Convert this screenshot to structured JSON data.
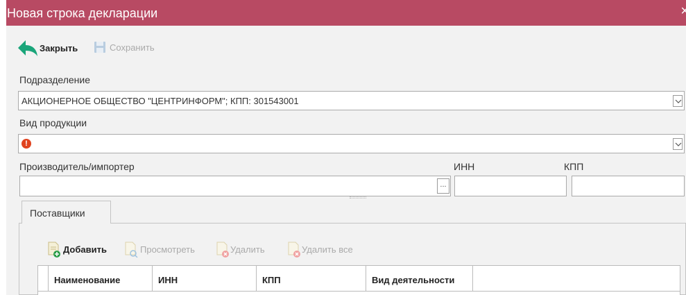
{
  "window": {
    "title": "Новая строка декларации",
    "close_glyph": "×"
  },
  "toolbar": {
    "close_label": "Закрыть",
    "save_label": "Сохранить"
  },
  "form": {
    "division_label": "Подразделение",
    "division_value": "АКЦИОНЕРНОЕ ОБЩЕСТВО \"ЦЕНТРИНФОРМ\"; КПП: 301543001",
    "product_type_label": "Вид продукции",
    "product_type_value": "",
    "producer_label": "Производитель/импортер",
    "producer_value": "",
    "inn_label": "ИНН",
    "inn_value": "",
    "kpp_label": "КПП",
    "kpp_value": "",
    "ellipsis_glyph": "..."
  },
  "tabs": [
    {
      "label": "Поставщики",
      "active": true
    }
  ],
  "suppliers_toolbar": {
    "add_label": "Добавить",
    "view_label": "Просмотреть",
    "delete_label": "Удалить",
    "delete_all_label": "Удалить все"
  },
  "table": {
    "columns": [
      "Наименование",
      "ИНН",
      "КПП",
      "Вид деятельности"
    ]
  },
  "colors": {
    "titlebar": "#b84a63",
    "back_arrow": "#1aa57a",
    "error_icon": "#e0431f"
  },
  "icons": [
    "back-arrow-icon",
    "save-disk-icon",
    "dropdown-chevron-icon",
    "error-icon",
    "add-document-icon",
    "view-document-icon",
    "delete-document-icon",
    "delete-all-document-icon"
  ]
}
